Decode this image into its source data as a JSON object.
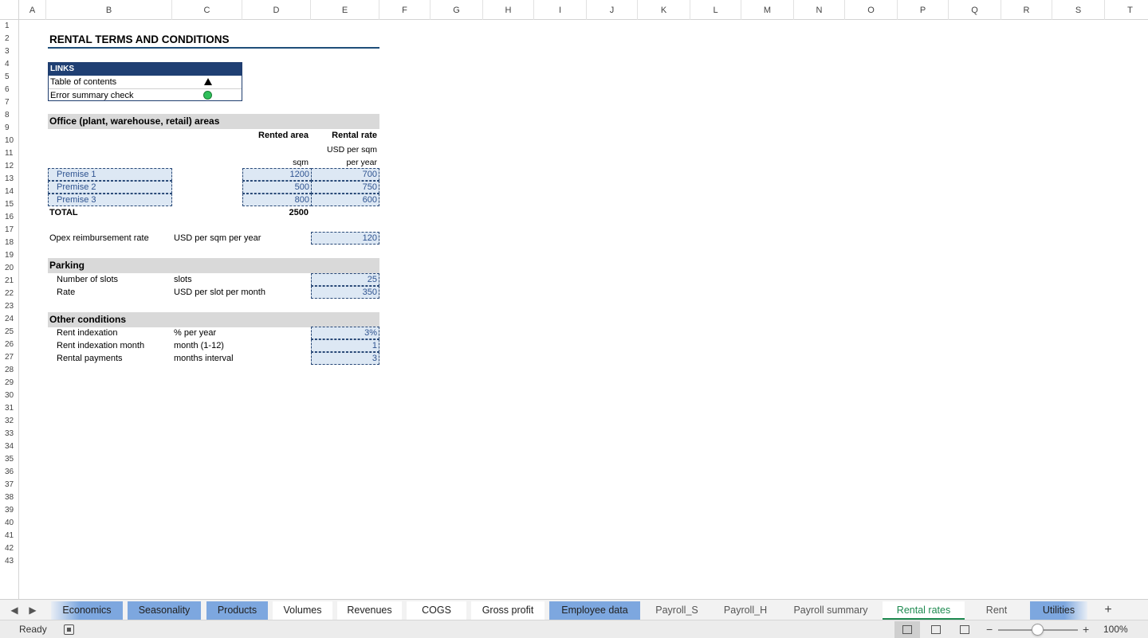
{
  "columns": [
    "A",
    "B",
    "C",
    "D",
    "E",
    "F",
    "G",
    "H",
    "I",
    "J",
    "K",
    "L",
    "M",
    "N",
    "O",
    "P",
    "Q",
    "R",
    "S",
    "T"
  ],
  "rows": [
    "1",
    "2",
    "3",
    "4",
    "5",
    "6",
    "7",
    "8",
    "9",
    "10",
    "11",
    "12",
    "13",
    "14",
    "15",
    "16",
    "17",
    "18",
    "19",
    "20",
    "21",
    "22",
    "23",
    "24",
    "25",
    "26",
    "27",
    "28",
    "29",
    "30",
    "31",
    "32",
    "33",
    "34",
    "35",
    "36",
    "37",
    "38",
    "39",
    "40",
    "41",
    "42",
    "43"
  ],
  "sheet": {
    "title": "RENTAL TERMS AND CONDITIONS",
    "links": {
      "header": "LINKS",
      "toc": "Table of contents",
      "error_check": "Error summary check"
    },
    "office": {
      "section_title": "Office (plant, warehouse, retail) areas",
      "col_area": "Rented area",
      "col_rate": "Rental rate",
      "rate_unit_1": "USD per sqm",
      "rate_unit_2": "per year",
      "area_unit": "sqm",
      "premises": [
        {
          "name": "Premise 1",
          "area": "1200",
          "rate": "700"
        },
        {
          "name": "Premise 2",
          "area": "500",
          "rate": "750"
        },
        {
          "name": "Premise 3",
          "area": "800",
          "rate": "600"
        }
      ],
      "total_label": "TOTAL",
      "total_area": "2500"
    },
    "opex": {
      "label": "Opex reimbursement rate",
      "unit": "USD per sqm per year",
      "value": "120"
    },
    "parking": {
      "section_title": "Parking",
      "slots_label": "Number of slots",
      "slots_unit": "slots",
      "slots_value": "25",
      "rate_label": "Rate",
      "rate_unit": "USD per slot per month",
      "rate_value": "350"
    },
    "other": {
      "section_title": "Other conditions",
      "indexation_label": "Rent indexation",
      "indexation_unit": "% per year",
      "indexation_value": "3%",
      "month_label": "Rent indexation month",
      "month_unit": "month (1-12)",
      "month_value": "1",
      "payments_label": "Rental payments",
      "payments_unit": "months interval",
      "payments_value": "3"
    }
  },
  "tabs": [
    {
      "label": "Economics",
      "style": "blue"
    },
    {
      "label": "Seasonality",
      "style": "blue"
    },
    {
      "label": "Products",
      "style": "blue"
    },
    {
      "label": "Volumes",
      "style": "white"
    },
    {
      "label": "Revenues",
      "style": "white"
    },
    {
      "label": "COGS",
      "style": "white"
    },
    {
      "label": "Gross profit",
      "style": "white"
    },
    {
      "label": "Employee data",
      "style": "blue"
    },
    {
      "label": "Payroll_S",
      "style": "plain"
    },
    {
      "label": "Payroll_H",
      "style": "plain"
    },
    {
      "label": "Payroll summary",
      "style": "plain"
    },
    {
      "label": "Rental rates",
      "style": "active"
    },
    {
      "label": "Rent",
      "style": "plain"
    },
    {
      "label": "Utilities",
      "style": "blue"
    }
  ],
  "status": {
    "ready": "Ready",
    "zoom": "100%"
  },
  "colors": {
    "accent_green": "#1e8a50",
    "tab_blue": "#7da7df",
    "links_header": "#1f3f73",
    "input_fill": "#dde8f4"
  }
}
